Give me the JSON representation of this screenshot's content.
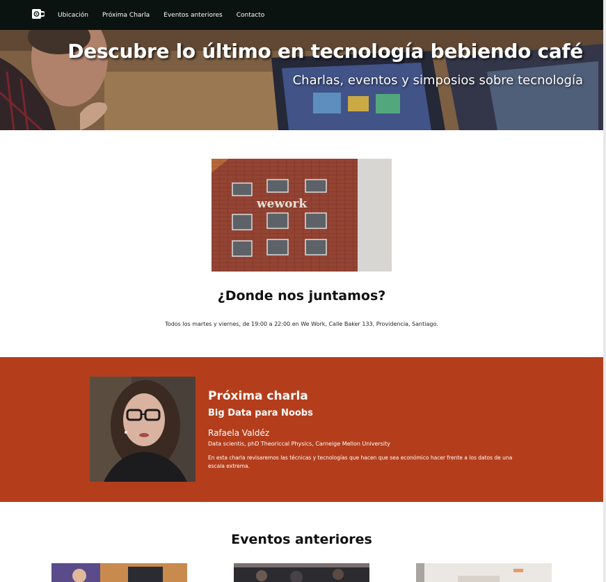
{
  "nav": {
    "brand_icon": "coffee-cup-icon",
    "links": [
      "Ubicación",
      "Próxima Charla",
      "Eventos anteriores",
      "Contacto"
    ]
  },
  "hero": {
    "title": "Descubre lo último en tecnología bebiendo café",
    "subtitle": "Charlas, eventos y simposios sobre tecnología"
  },
  "location": {
    "title": "¿Donde nos juntamos?",
    "text": "Todos los martes y viernes, de 19:00 a 22:00 en We Work, Calle Baker 133, Providencia, Santiago."
  },
  "next_talk": {
    "heading": "Próxima charla",
    "title": "Big Data para Noobs",
    "speaker": "Rafaela Valdéz",
    "bio": "Data scientis, phD Theoriccal Physics, Carneige Mellon University",
    "description": "En esta charla revisaremos las técnicas y tecnologías que hacen que sea económico hacer frente a los datos de una escala extrema."
  },
  "past_events": {
    "title": "Eventos anteriores"
  },
  "colors": {
    "navbar": "#0b1310",
    "accent": "#b43e1c",
    "background": "#ffffff"
  }
}
